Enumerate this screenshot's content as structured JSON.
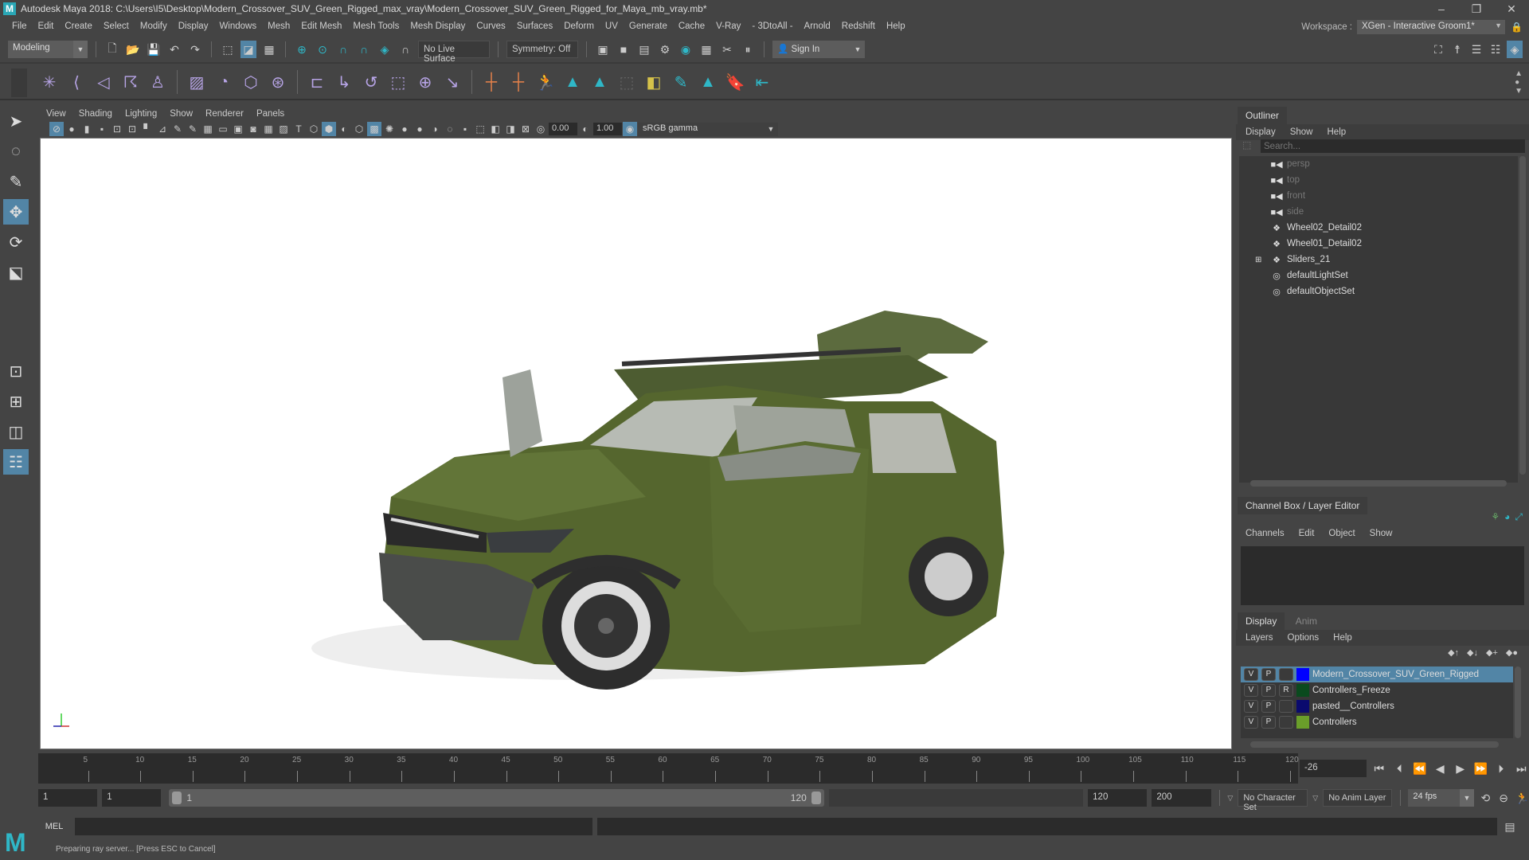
{
  "window": {
    "title": "Autodesk Maya 2018: C:\\Users\\I5\\Desktop\\Modern_Crossover_SUV_Green_Rigged_max_vray\\Modern_Crossover_SUV_Green_Rigged_for_Maya_mb_vray.mb*",
    "controls": {
      "minimize": "–",
      "restore": "❐",
      "close": "✕"
    }
  },
  "menubar": {
    "items": [
      "File",
      "Edit",
      "Create",
      "Select",
      "Modify",
      "Display",
      "Windows",
      "Mesh",
      "Edit Mesh",
      "Mesh Tools",
      "Mesh Display",
      "Curves",
      "Surfaces",
      "Deform",
      "UV",
      "Generate",
      "Cache",
      "V-Ray",
      "- 3DtoAll -",
      "Arnold",
      "Redshift",
      "Help"
    ],
    "workspace_label": "Workspace :",
    "workspace_value": "XGen - Interactive Groom1*"
  },
  "statusline": {
    "menuset": "Modeling",
    "live_surface": "No Live Surface",
    "symmetry": "Symmetry: Off",
    "sign_in": "Sign In"
  },
  "viewport": {
    "menu": [
      "View",
      "Shading",
      "Lighting",
      "Show",
      "Renderer",
      "Panels"
    ],
    "exposure": "0.00",
    "gamma": "1.00",
    "color_space": "sRGB gamma",
    "axis": {
      "y": "y",
      "z": "z",
      "x": "x"
    }
  },
  "outliner": {
    "tab": "Outliner",
    "menu": [
      "Display",
      "Show",
      "Help"
    ],
    "search_placeholder": "Search...",
    "items": [
      {
        "name": "persp",
        "icon": "camera-icon",
        "dim": true
      },
      {
        "name": "top",
        "icon": "camera-icon",
        "dim": true
      },
      {
        "name": "front",
        "icon": "camera-icon",
        "dim": true
      },
      {
        "name": "side",
        "icon": "camera-icon",
        "dim": true
      },
      {
        "name": "Wheel02_Detail02",
        "icon": "transform-icon",
        "dim": false
      },
      {
        "name": "Wheel01_Detail02",
        "icon": "transform-icon",
        "dim": false
      },
      {
        "name": "Sliders_21",
        "icon": "transform-icon",
        "dim": false,
        "expandable": true
      },
      {
        "name": "defaultLightSet",
        "icon": "set-icon",
        "dim": false
      },
      {
        "name": "defaultObjectSet",
        "icon": "set-icon",
        "dim": false
      }
    ]
  },
  "channelbox": {
    "tab": "Channel Box / Layer Editor",
    "menu": [
      "Channels",
      "Edit",
      "Object",
      "Show"
    ]
  },
  "layer_editor": {
    "tabs": [
      "Display",
      "Anim"
    ],
    "menu": [
      "Layers",
      "Options",
      "Help"
    ],
    "layers": [
      {
        "v": "V",
        "p": "P",
        "r": "",
        "color": "#0000ff",
        "name": "Modern_Crossover_SUV_Green_Rigged",
        "selected": true
      },
      {
        "v": "V",
        "p": "P",
        "r": "R",
        "color": "#0a4a1e",
        "name": "Controllers_Freeze",
        "selected": false
      },
      {
        "v": "V",
        "p": "P",
        "r": "",
        "color": "#0a0a6e",
        "name": "pasted__Controllers",
        "selected": false
      },
      {
        "v": "V",
        "p": "P",
        "r": "",
        "color": "#6a9e2a",
        "name": "Controllers",
        "selected": false
      }
    ]
  },
  "timeline": {
    "ticks": [
      5,
      10,
      15,
      20,
      25,
      30,
      35,
      40,
      45,
      50,
      55,
      60,
      65,
      70,
      75,
      80,
      85,
      90,
      95,
      100,
      105,
      110,
      115,
      120
    ],
    "min": 1,
    "max": 120,
    "current_frame": "-26"
  },
  "range": {
    "start": "1",
    "playback_start": "1",
    "slider_start": "1",
    "slider_end": "120",
    "playback_end": "120",
    "end": "200",
    "character_set": "No Character Set",
    "anim_layer": "No Anim Layer",
    "fps": "24 fps"
  },
  "cmdline": {
    "label": "MEL"
  },
  "helpline": {
    "text": "Preparing ray server... [Press ESC to Cancel]"
  }
}
